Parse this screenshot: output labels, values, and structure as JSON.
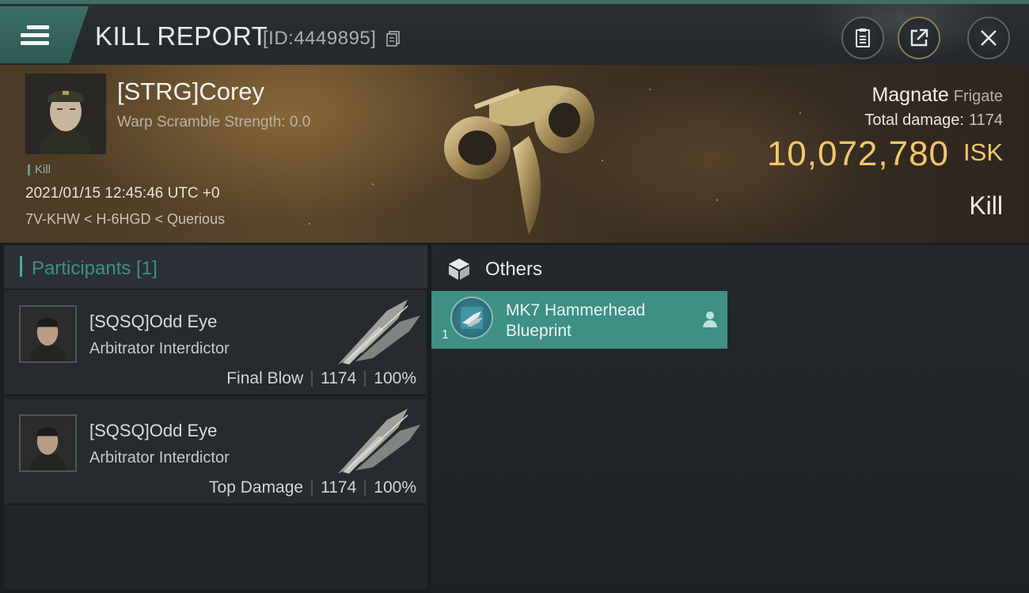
{
  "header": {
    "title": "KILL REPORT",
    "report_id": "[ID:4449895]"
  },
  "victim": {
    "name": "[STRG]Corey",
    "warp_scramble": "Warp Scramble Strength: 0.0",
    "tag": "Kill",
    "timestamp": "2021/01/15 12:45:46 UTC +0",
    "location": "7V-KHW < H-6HGD < Querious",
    "ship_name": "Magnate",
    "ship_class": "Frigate",
    "damage_label": "Total damage:",
    "damage_value": "1174",
    "isk_value": "10,072,780",
    "isk_unit": "ISK",
    "result": "Kill"
  },
  "participants": {
    "heading": "Participants [1]",
    "items": [
      {
        "name": "[SQSQ]Odd Eye",
        "ship": "Arbitrator Interdictor",
        "role": "Final Blow",
        "damage": "1174",
        "percent": "100%"
      },
      {
        "name": "[SQSQ]Odd Eye",
        "ship": "Arbitrator Interdictor",
        "role": "Top Damage",
        "damage": "1174",
        "percent": "100%"
      }
    ]
  },
  "others": {
    "heading": "Others",
    "items": [
      {
        "name": "MK7 Hammerhead Blueprint",
        "quantity": "1"
      }
    ]
  },
  "colors": {
    "accent": "#3e8f84",
    "isk": "#f2c66b"
  },
  "icons": [
    "menu-icon",
    "copy-icon",
    "clipboard-icon",
    "share-icon",
    "close-icon",
    "cube-icon",
    "person-icon"
  ]
}
